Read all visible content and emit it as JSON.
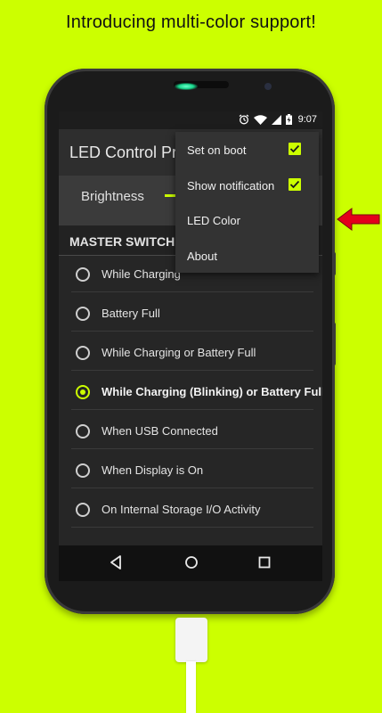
{
  "banner": {
    "text": "Introducing multi-color support!"
  },
  "status": {
    "time": "9:07",
    "icons": [
      "alarm-icon",
      "wifi-icon",
      "signal-icon",
      "battery-charging-icon"
    ]
  },
  "app": {
    "title": "LED Control Pro"
  },
  "brightness": {
    "label": "Brightness"
  },
  "master": {
    "label": "MASTER SWITCH"
  },
  "options": [
    {
      "label": "While Charging",
      "selected": false
    },
    {
      "label": "Battery Full",
      "selected": false
    },
    {
      "label": "While Charging or Battery Full",
      "selected": false
    },
    {
      "label": "While Charging (Blinking) or Battery Full",
      "selected": true
    },
    {
      "label": "When USB Connected",
      "selected": false
    },
    {
      "label": "When Display is On",
      "selected": false
    },
    {
      "label": "On Internal Storage I/O Activity",
      "selected": false
    }
  ],
  "menu": {
    "items": [
      {
        "label": "Set on boot",
        "checked": true
      },
      {
        "label": "Show notification",
        "checked": true
      },
      {
        "label": "LED Color"
      },
      {
        "label": "About"
      }
    ]
  },
  "nav": {
    "icons": [
      "back-icon",
      "home-icon",
      "recents-icon"
    ]
  },
  "colors": {
    "background": "#ccff00",
    "accent": "#ccff00",
    "arrow": "#e3001b"
  }
}
